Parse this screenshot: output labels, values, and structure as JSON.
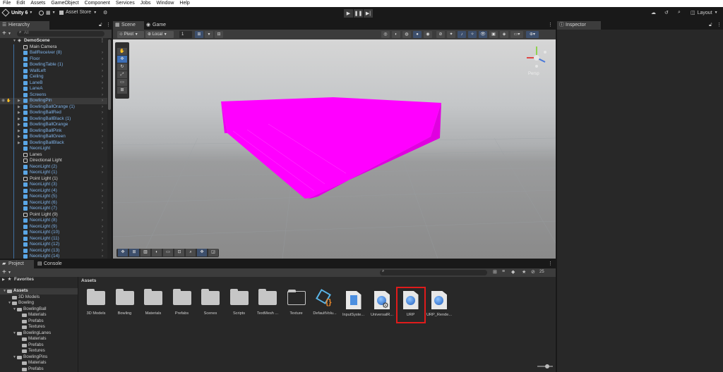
{
  "menu": [
    "File",
    "Edit",
    "Assets",
    "GameObject",
    "Component",
    "Services",
    "Jobs",
    "Window",
    "Help"
  ],
  "toolbar": {
    "app_label": "Unity 6",
    "asset_store": "Asset Store",
    "layout": "Layout"
  },
  "hierarchy": {
    "tab": "Hierarchy",
    "search_placeholder": "All",
    "scene": "DemoScene",
    "items": [
      {
        "label": "Main Camera",
        "type": "gray",
        "depth": 1
      },
      {
        "label": "BallReceiver (8)",
        "type": "blue",
        "depth": 1
      },
      {
        "label": "Floor",
        "type": "blue",
        "depth": 1
      },
      {
        "label": "BowlingTable (1)",
        "type": "blue",
        "depth": 1
      },
      {
        "label": "WallLeft",
        "type": "blue",
        "depth": 1
      },
      {
        "label": "Ceiling",
        "type": "blue",
        "depth": 1
      },
      {
        "label": "LaneB",
        "type": "blue",
        "depth": 1
      },
      {
        "label": "LaneA",
        "type": "blue",
        "depth": 1
      },
      {
        "label": "Screens",
        "type": "blue",
        "depth": 1
      },
      {
        "label": "BowlingPin",
        "type": "blue",
        "depth": 1,
        "expandable": true,
        "selected": true
      },
      {
        "label": "BowlingBallOrange (1)",
        "type": "blue",
        "depth": 1,
        "expandable": true
      },
      {
        "label": "BowlingBallRed",
        "type": "blue",
        "depth": 1,
        "expandable": true
      },
      {
        "label": "BowlingBallBlack (1)",
        "type": "blue",
        "depth": 1,
        "expandable": true
      },
      {
        "label": "BowlingBallOrange",
        "type": "blue",
        "depth": 1,
        "expandable": true
      },
      {
        "label": "BowlingBallPink",
        "type": "blue",
        "depth": 1,
        "expandable": true
      },
      {
        "label": "BowlingBallGreen",
        "type": "blue",
        "depth": 1,
        "expandable": true
      },
      {
        "label": "BowlingBallBlack",
        "type": "blue",
        "depth": 1,
        "expandable": true
      },
      {
        "label": "NeonLight",
        "type": "blue",
        "depth": 1
      },
      {
        "label": "Lanes",
        "type": "gray",
        "depth": 1
      },
      {
        "label": "Directional Light",
        "type": "gray",
        "depth": 1
      },
      {
        "label": "NeonLight (2)",
        "type": "blue",
        "depth": 1
      },
      {
        "label": "NeonLight (1)",
        "type": "blue",
        "depth": 1
      },
      {
        "label": "Point Light (1)",
        "type": "gray",
        "depth": 1
      },
      {
        "label": "NeonLight (3)",
        "type": "blue",
        "depth": 1
      },
      {
        "label": "NeonLight (4)",
        "type": "blue",
        "depth": 1
      },
      {
        "label": "NeonLight (5)",
        "type": "blue",
        "depth": 1
      },
      {
        "label": "NeonLight (6)",
        "type": "blue",
        "depth": 1
      },
      {
        "label": "NeonLight (7)",
        "type": "blue",
        "depth": 1
      },
      {
        "label": "Point Light (9)",
        "type": "gray",
        "depth": 1
      },
      {
        "label": "NeonLight (8)",
        "type": "blue",
        "depth": 1
      },
      {
        "label": "NeonLight (9)",
        "type": "blue",
        "depth": 1
      },
      {
        "label": "NeonLight (10)",
        "type": "blue",
        "depth": 1
      },
      {
        "label": "NeonLight (11)",
        "type": "blue",
        "depth": 1
      },
      {
        "label": "NeonLight (12)",
        "type": "blue",
        "depth": 1
      },
      {
        "label": "NeonLight (13)",
        "type": "blue",
        "depth": 1
      },
      {
        "label": "NeonLight (14)",
        "type": "blue",
        "depth": 1
      }
    ]
  },
  "scene_tabs": {
    "scene": "Scene",
    "game": "Game"
  },
  "scene_toolbar": {
    "pivot": "Pivot",
    "local": "Local",
    "snap": "1"
  },
  "gizmo": {
    "persp": "Persp"
  },
  "inspector": {
    "tab": "Inspector"
  },
  "project": {
    "tabs": [
      "Project",
      "Console"
    ],
    "favorites": "Favorites",
    "breadcrumb": "Assets",
    "hidden_count": "25",
    "tree": [
      {
        "label": "Assets",
        "depth": 0,
        "open": true
      },
      {
        "label": "3D Models",
        "depth": 1
      },
      {
        "label": "Bowling",
        "depth": 1,
        "open": true
      },
      {
        "label": "BowlingBall",
        "depth": 2,
        "open": true
      },
      {
        "label": "Materials",
        "depth": 3
      },
      {
        "label": "Prefabs",
        "depth": 3
      },
      {
        "label": "Textures",
        "depth": 3
      },
      {
        "label": "BowlingLanes",
        "depth": 2,
        "open": true
      },
      {
        "label": "Materials",
        "depth": 3
      },
      {
        "label": "Prefabs",
        "depth": 3
      },
      {
        "label": "Textures",
        "depth": 3
      },
      {
        "label": "BowlingPins",
        "depth": 2,
        "open": true
      },
      {
        "label": "Materials",
        "depth": 3
      },
      {
        "label": "Prefabs",
        "depth": 3
      }
    ],
    "assets": [
      {
        "label": "3D Models",
        "kind": "folder"
      },
      {
        "label": "Bowling",
        "kind": "folder"
      },
      {
        "label": "Materials",
        "kind": "folder"
      },
      {
        "label": "Prefabs",
        "kind": "folder"
      },
      {
        "label": "Scenes",
        "kind": "folder"
      },
      {
        "label": "Scripts",
        "kind": "folder"
      },
      {
        "label": "TextMesh ...",
        "kind": "folder"
      },
      {
        "label": "Texture",
        "kind": "folder-empty"
      },
      {
        "label": "DefaultVolu...",
        "kind": "volume"
      },
      {
        "label": "InputSyste...",
        "kind": "input"
      },
      {
        "label": "UniversalR...",
        "kind": "urp-gear"
      },
      {
        "label": "URP",
        "kind": "urp",
        "highlighted": true
      },
      {
        "label": "URP_Rende...",
        "kind": "urp"
      }
    ]
  },
  "colors": {
    "magenta": "#ff00ff",
    "highlight": "#e01b1b",
    "blue_text": "#7fb2e8",
    "accent": "#3d6eb4"
  }
}
